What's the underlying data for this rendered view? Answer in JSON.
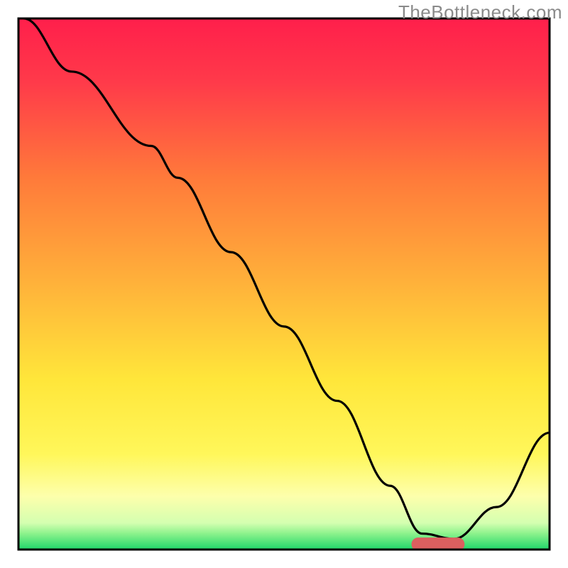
{
  "watermark": "TheBottleneck.com",
  "chart_data": {
    "type": "line",
    "title": "",
    "xlabel": "",
    "ylabel": "",
    "xlim": [
      0,
      100
    ],
    "ylim": [
      0,
      100
    ],
    "grid": false,
    "legend": false,
    "gradient_bands": [
      {
        "y_from": 100,
        "y_to": 90,
        "label": "red"
      },
      {
        "y_from": 90,
        "y_to": 40,
        "label": "orange"
      },
      {
        "y_from": 40,
        "y_to": 20,
        "label": "yellow"
      },
      {
        "y_from": 20,
        "y_to": 5,
        "label": "pale-yellow"
      },
      {
        "y_from": 5,
        "y_to": 0,
        "label": "green"
      }
    ],
    "series": [
      {
        "name": "bottleneck-curve",
        "x": [
          1,
          10,
          25,
          30,
          40,
          50,
          60,
          70,
          76,
          82,
          90,
          100
        ],
        "y": [
          100,
          90,
          76,
          70,
          56,
          42,
          28,
          12,
          3,
          2,
          8,
          22
        ]
      }
    ],
    "annotations": [
      {
        "name": "optimal-marker",
        "shape": "capsule",
        "x_center": 79,
        "y_center": 1,
        "width": 10,
        "height": 2.5,
        "color": "#db5f5f"
      }
    ]
  }
}
